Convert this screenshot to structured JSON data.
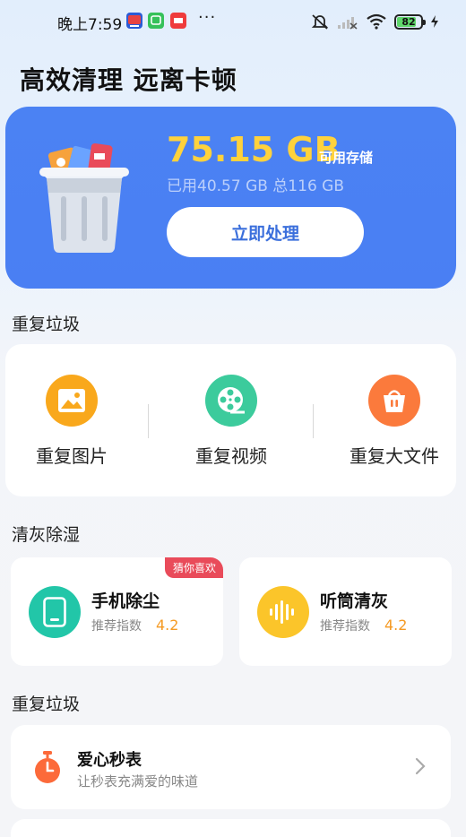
{
  "status_bar": {
    "time": "晚上7:59",
    "apps": [
      "cctv-app-icon",
      "wechat-app-icon",
      "redbook-app-icon"
    ],
    "more_dots": "···",
    "icons": [
      "mute-icon",
      "signal-icon",
      "wifi-icon"
    ],
    "battery_level": "82",
    "battery_fraction": 0.82,
    "charging": true
  },
  "page_title": "高效清理 远离卡顿",
  "storage": {
    "available": "75.15 GB",
    "available_label": "可用存储",
    "usage": "已用40.57 GB 总116 GB",
    "action_label": "立即处理"
  },
  "sections": {
    "duplicate_title": "重复垃圾",
    "dust_title": "清灰除湿",
    "more_title": "重复垃圾"
  },
  "duplicate_items": [
    {
      "label": "重复图片",
      "icon": "image-icon",
      "color": "#f9a81c"
    },
    {
      "label": "重复视频",
      "icon": "film-reel-icon",
      "color": "#3ccb9c"
    },
    {
      "label": "重复大文件",
      "icon": "basket-icon",
      "color": "#fb7a3c"
    }
  ],
  "dust_items": [
    {
      "title": "手机除尘",
      "sub": "推荐指数",
      "score": "4.2",
      "badge": "猜你喜欢",
      "icon": "phone-icon",
      "color": "#22c6a8"
    },
    {
      "title": "听筒清灰",
      "sub": "推荐指数",
      "score": "4.2",
      "icon": "soundwave-icon",
      "color": "#fbc52a"
    }
  ],
  "list_items": [
    {
      "title": "爱心秒表",
      "sub": "让秒表充满爱的味道",
      "icon": "stopwatch-icon",
      "color": "#fc6a3a"
    }
  ],
  "colors": {
    "accent_blue": "#4a7ff3",
    "highlight_yellow": "#ffd23c",
    "score_orange": "#f59a23",
    "badge_red": "#e94b5a"
  }
}
